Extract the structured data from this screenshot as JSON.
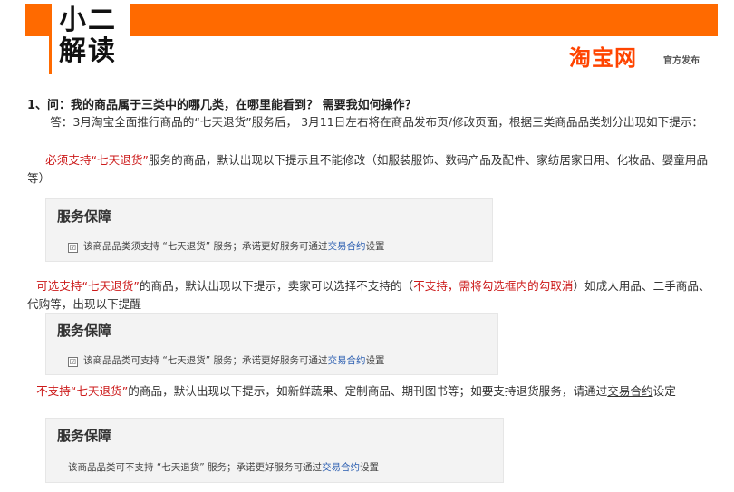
{
  "header": {
    "logo_line1": "小二",
    "logo_line2": "解读",
    "brand": "淘宝网",
    "brand_sub": "官方发布"
  },
  "question": "1、问：我的商品属于三类中的哪几类，在哪里能看到？ 需要我如何操作？",
  "answer": "答：3月淘宝全面推行商品的“七天退货”服务后， 3月11日左右将在商品发布页/修改页面，根据三类商品品类划分出现如下提示：",
  "section1": {
    "lead_red": "必须支持“七天退货”",
    "text": "服务的商品，默认出现以下提示且不能修改（如服装服饰、数码产品及配件、家纺居家日用、化妆品、婴童用品等）"
  },
  "card1": {
    "title": "服务保障",
    "checkbox_mark": "☑",
    "text": "该商品品类须支持 “七天退货” 服务；承诺更好服务可通过",
    "link": "交易合约",
    "suffix": "设置"
  },
  "section2": {
    "lead_red": "可选支持“七天退货”",
    "text": "的商品，默认出现以下提示，卖家可以选择不支持的（",
    "inline_red": "不支持，需将勾选框内的勾取消",
    "text_end": "）如成人用品、二手商品、代购等，出现以下提醒"
  },
  "card2": {
    "title": "服务保障",
    "checkbox_mark": "☑",
    "text": "该商品品类可支持 “七天退货” 服务；承诺更好服务可通过",
    "link": "交易合约",
    "suffix": "设置"
  },
  "section3": {
    "lead_red": "不支持“七天退货”",
    "text": "的商品，默认出现以下提示，如新鲜蔬果、定制商品、期刊图书等；如要支持退货服务，请通过",
    "link": "交易合约",
    "suffix": "设定"
  },
  "card3": {
    "title": "服务保障",
    "text": "该商品品类可不支持 “七天退货” 服务；承诺更好服务可通过",
    "link": "交易合约",
    "suffix": "设置"
  }
}
